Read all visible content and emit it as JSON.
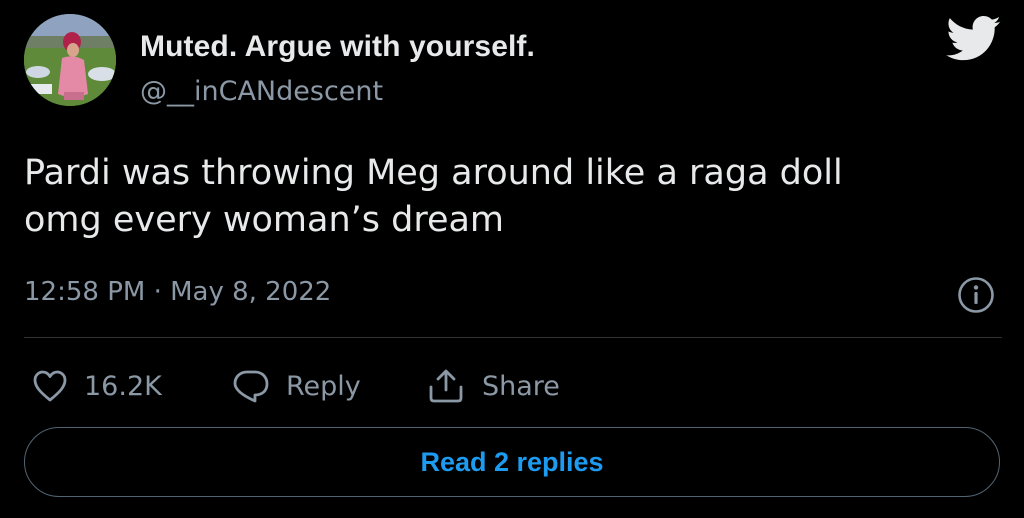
{
  "author": {
    "display_name": "Muted. Argue with yourself.",
    "handle": "@__inCANdescent",
    "avatar": "profile-photo"
  },
  "tweet": {
    "lines": [
      "Pardi was throwing Meg around like a raga doll",
      "omg every woman’s dream"
    ],
    "timestamp": "12:58 PM · May 8, 2022"
  },
  "actions": {
    "like": {
      "icon": "heart-icon",
      "count": "16.2K"
    },
    "reply": {
      "icon": "reply-icon",
      "label": "Reply"
    },
    "share": {
      "icon": "share-icon",
      "label": "Share"
    }
  },
  "read_replies": {
    "label": "Read 2 replies"
  },
  "icons": {
    "brand": "twitter-bird-icon",
    "info": "info-icon"
  },
  "colors": {
    "background": "#000000",
    "text": "#e7e9ea",
    "secondary": "#8b98a5",
    "accent": "#1d9bf0",
    "divider": "#2f3336"
  }
}
